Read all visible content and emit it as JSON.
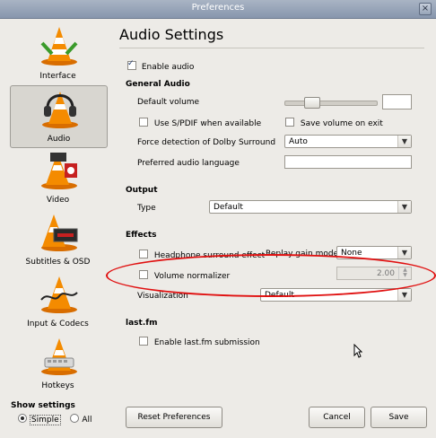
{
  "window": {
    "title": "Preferences"
  },
  "sidebar": {
    "items": [
      {
        "label": "Interface"
      },
      {
        "label": "Audio"
      },
      {
        "label": "Video"
      },
      {
        "label": "Subtitles & OSD"
      },
      {
        "label": "Input & Codecs"
      },
      {
        "label": "Hotkeys"
      }
    ],
    "selected": "Audio"
  },
  "show_settings": {
    "label": "Show settings",
    "simple": "Simple",
    "all": "All",
    "selected": "Simple"
  },
  "panel": {
    "title": "Audio Settings",
    "enable_audio": "Enable audio",
    "general_audio": {
      "heading": "General Audio",
      "default_volume": "Default volume",
      "spdif": "Use S/PDIF when available",
      "save_volume": "Save volume on exit",
      "dolby_label": "Force detection of Dolby Surround",
      "dolby_value": "Auto",
      "preferred_lang": "Preferred audio language"
    },
    "output": {
      "heading": "Output",
      "type_label": "Type",
      "type_value": "Default"
    },
    "effects": {
      "heading": "Effects",
      "headphone": "Headphone surround effect",
      "replay_label": "Replay gain mode",
      "replay_value": "None",
      "normalizer": "Volume normalizer",
      "normalizer_value": "2.00",
      "visualization_label": "Visualization",
      "visualization_value": "Default"
    },
    "lastfm": {
      "heading": "last.fm",
      "enable": "Enable last.fm submission"
    }
  },
  "buttons": {
    "reset": "Reset Preferences",
    "cancel": "Cancel",
    "save": "Save"
  },
  "colors": {
    "highlight_ring": "#e01010",
    "title_bar": "#8796ad"
  }
}
